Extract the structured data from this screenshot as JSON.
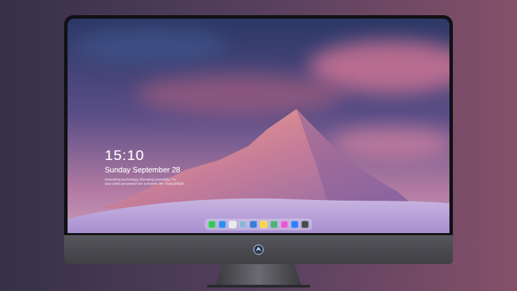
{
  "desktop": {
    "time": "15:10",
    "date": "Sunday September 28",
    "tagline": [
      "Innovating technology, Elevating possibility. I'm",
      "your ideal companion for a smarter life. XuanJieEdit"
    ]
  },
  "dock": {
    "items": [
      {
        "color": "#34c759"
      },
      {
        "color": "#2f8cf0"
      },
      {
        "color": "#e9e9ee"
      },
      {
        "color": "#8fb3d9"
      },
      {
        "color": "#3a7bd5"
      },
      {
        "color": "#f5d547"
      },
      {
        "color": "#4caf7d"
      },
      {
        "color": "#e35bd3"
      },
      {
        "color": "#2d7ff9"
      },
      {
        "color": "#4a4a50"
      }
    ]
  }
}
